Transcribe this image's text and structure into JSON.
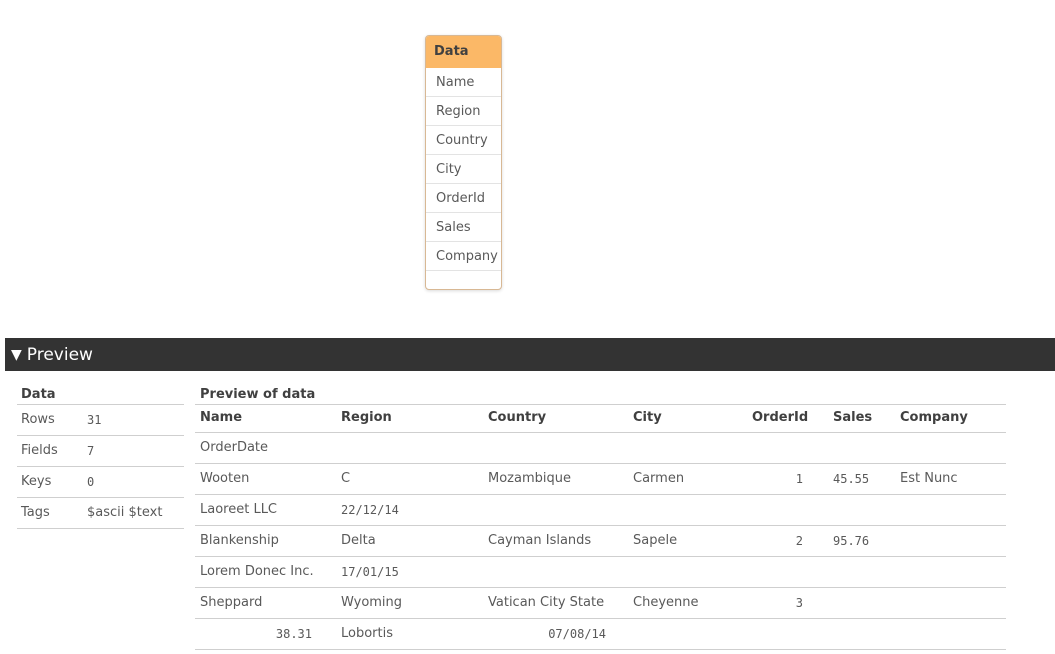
{
  "table_card": {
    "name": "Data",
    "fields": [
      "Name",
      "Region",
      "Country",
      "City",
      "OrderId",
      "Sales",
      "Company"
    ]
  },
  "preview_header": {
    "label": "Preview",
    "toggle_icon": "triangle-down-icon"
  },
  "summary": {
    "title": "Data",
    "rows": [
      {
        "key": "Rows",
        "value": "31"
      },
      {
        "key": "Fields",
        "value": "7"
      },
      {
        "key": "Keys",
        "value": "0"
      },
      {
        "key": "Tags",
        "value": "$ascii $text"
      }
    ]
  },
  "preview_table": {
    "title": "Preview of data",
    "columns": [
      "Name",
      "Region",
      "Country",
      "City",
      "OrderId",
      "Sales",
      "Company"
    ],
    "rows": [
      {
        "c0": "OrderDate"
      },
      {
        "c0": "Wooten",
        "c1": "C",
        "c2": "Mozambique",
        "c3": "Carmen",
        "c4": "1",
        "c5": "45.55",
        "c6": "Est Nunc"
      },
      {
        "c0": "Laoreet LLC",
        "c1": "22/12/14"
      },
      {
        "c0": "Blankenship",
        "c1": "Delta",
        "c2": "Cayman Islands",
        "c3": "Sapele",
        "c4": "2",
        "c5": "95.76"
      },
      {
        "c0": "Lorem Donec Inc.",
        "c1": "17/01/15"
      },
      {
        "c0": "Sheppard",
        "c1": "Wyoming",
        "c2": "Vatican City State",
        "c3": "Cheyenne",
        "c4": "3"
      },
      {
        "c0": "38.31",
        "c1": "Lobortis",
        "c2": "07/08/14"
      }
    ]
  },
  "colors": {
    "card_header": "#fbb867",
    "card_border": "#d8b894",
    "preview_bar": "#333333"
  }
}
